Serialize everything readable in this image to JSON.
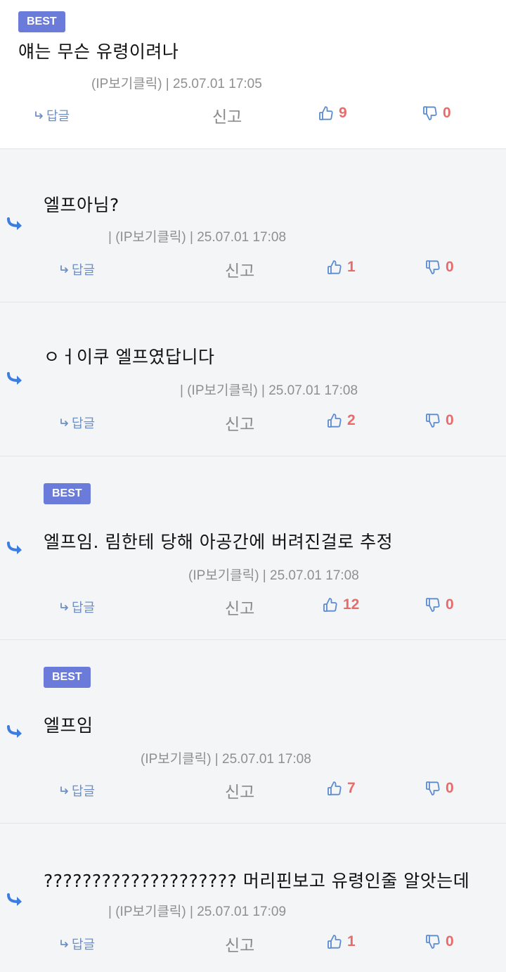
{
  "common": {
    "best_label": "BEST",
    "reply_label": "답글",
    "report_label": "신고",
    "ip_label": "(IP보기클릭)"
  },
  "comments": [
    {
      "best": true,
      "text": "얘는 무슨 유령이려나",
      "meta": "(IP보기클릭) | 25.07.01 17:05",
      "likes": "9",
      "dislikes": "0"
    },
    {
      "best": false,
      "text": "엘프아님?",
      "meta": "| (IP보기클릭) | 25.07.01 17:08",
      "likes": "1",
      "dislikes": "0"
    },
    {
      "best": false,
      "text": "ㅇㅓ이쿠 엘프였답니다",
      "meta": "| (IP보기클릭) | 25.07.01 17:08",
      "likes": "2",
      "dislikes": "0"
    },
    {
      "best": true,
      "text": "엘프임. 림한테 당해 아공간에 버려진걸로 추정",
      "meta": "(IP보기클릭) | 25.07.01 17:08",
      "likes": "12",
      "dislikes": "0"
    },
    {
      "best": true,
      "text": "엘프임",
      "meta": "(IP보기클릭) | 25.07.01 17:08",
      "likes": "7",
      "dislikes": "0"
    },
    {
      "best": false,
      "text": "???????????????????? 머리핀보고 유령인줄 알앗는데",
      "meta": "| (IP보기클릭) | 25.07.01 17:09",
      "likes": "1",
      "dislikes": "0"
    }
  ],
  "colors": {
    "accent": "#6b7bd9",
    "like": "#e86b6b",
    "icon": "#5b8bd0"
  }
}
